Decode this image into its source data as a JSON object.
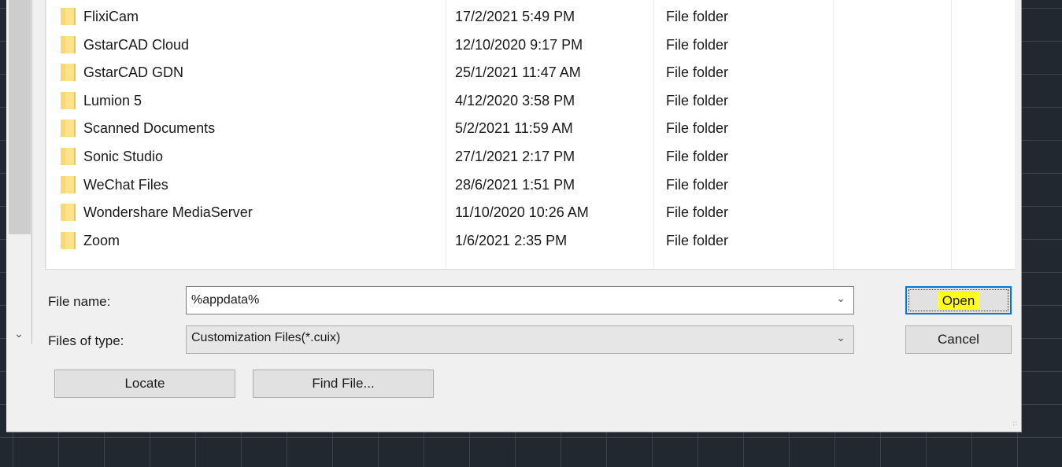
{
  "files": [
    {
      "name": "FlixiCam",
      "date": "17/2/2021 5:49 PM",
      "type": "File folder"
    },
    {
      "name": "GstarCAD Cloud",
      "date": "12/10/2020 9:17 PM",
      "type": "File folder"
    },
    {
      "name": "GstarCAD GDN",
      "date": "25/1/2021 11:47 AM",
      "type": "File folder"
    },
    {
      "name": "Lumion 5",
      "date": "4/12/2020 3:58 PM",
      "type": "File folder"
    },
    {
      "name": "Scanned Documents",
      "date": "5/2/2021 11:59 AM",
      "type": "File folder"
    },
    {
      "name": "Sonic Studio",
      "date": "27/1/2021 2:17 PM",
      "type": "File folder"
    },
    {
      "name": "WeChat Files",
      "date": "28/6/2021 1:51 PM",
      "type": "File folder"
    },
    {
      "name": "Wondershare MediaServer",
      "date": "11/10/2020 10:26 AM",
      "type": "File folder"
    },
    {
      "name": "Zoom",
      "date": "1/6/2021 2:35 PM",
      "type": "File folder"
    }
  ],
  "form": {
    "file_name_label": "File name:",
    "file_name_value": "%appdata%",
    "files_of_type_label": "Files of type:",
    "files_of_type_value": "Customization Files(*.cuix)"
  },
  "buttons": {
    "open": "Open",
    "cancel": "Cancel",
    "locate": "Locate",
    "find_file": "Find File..."
  },
  "icons": {
    "folder": "folder-icon",
    "dropdown": "chevron-down-icon",
    "scroll_down": "scroll-down-icon",
    "resize_grip": "resize-grip-icon"
  },
  "colors": {
    "highlight": "#ffff1a",
    "focus_border": "#0078d7",
    "folder": "#fce28a"
  }
}
